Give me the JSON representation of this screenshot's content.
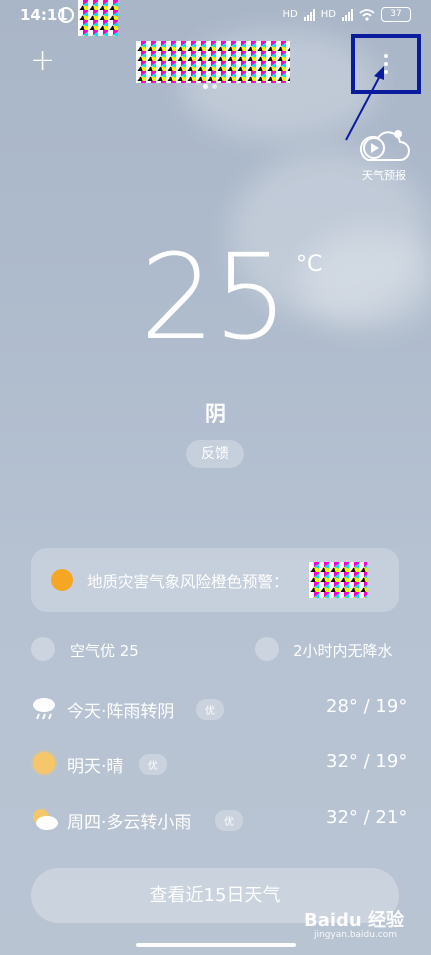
{
  "status": {
    "time": "14:11",
    "net1": "HD",
    "net2": "HD",
    "battery": "37"
  },
  "top": {
    "add_symbol": "+"
  },
  "forecast_video": {
    "label": "天气预报"
  },
  "current": {
    "temperature": "25",
    "unit": "°C",
    "condition": "阴",
    "feedback": "反馈"
  },
  "alert": {
    "text": "地质灾害气象风险橙色预警："
  },
  "summary": {
    "air": "空气优 25",
    "rain": "2小时内无降水"
  },
  "daily": [
    {
      "label": "今天·阵雨转阴",
      "badge": "优",
      "range": "28° / 19°"
    },
    {
      "label": "明天·晴",
      "badge": "优",
      "range": "32° / 19°"
    },
    {
      "label": "周四·多云转小雨",
      "badge": "优",
      "range": "32° / 21°"
    }
  ],
  "button_15day": "查看近15日天气",
  "watermark": {
    "brand": "Baidu 经验",
    "url": "jingyan.baidu.com"
  }
}
